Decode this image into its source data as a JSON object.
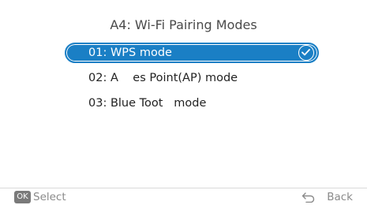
{
  "screen": {
    "title": "A4: Wi-Fi Pairing Modes"
  },
  "menu": {
    "items": [
      {
        "label": "01: WPS mode",
        "selected": true
      },
      {
        "label": "02: A    es Point(AP) mode",
        "selected": false
      },
      {
        "label": "03: Blue Toot   mode",
        "selected": false
      }
    ],
    "selected_icon": "check-circle-icon"
  },
  "footer": {
    "ok_badge": "OK",
    "select_label": "Select",
    "back_icon": "return-arrow-icon",
    "back_label": "Back"
  },
  "colors": {
    "accent": "#1a7fc5",
    "background": "#ffffff",
    "text": "#222222",
    "muted": "#8a8a8a"
  }
}
